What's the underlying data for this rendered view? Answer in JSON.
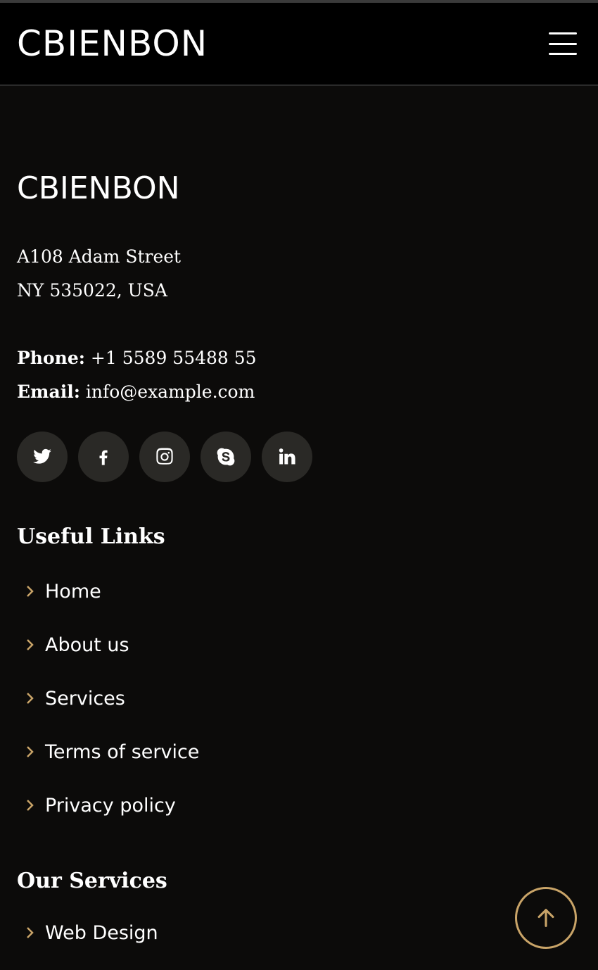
{
  "header": {
    "brand": "CBIENBON",
    "menu_icon": "hamburger-menu-icon"
  },
  "footer": {
    "brand": "CBIENBON",
    "address": {
      "line1": "A108 Adam Street",
      "line2": "NY 535022, USA"
    },
    "phone": {
      "label": "Phone:",
      "value": "+1 5589 55488 55"
    },
    "email": {
      "label": "Email:",
      "value": "info@example.com"
    },
    "social": [
      "twitter-icon",
      "facebook-icon",
      "instagram-icon",
      "skype-icon",
      "linkedin-icon"
    ],
    "useful_links": {
      "heading": "Useful Links",
      "items": [
        "Home",
        "About us",
        "Services",
        "Terms of service",
        "Privacy policy"
      ]
    },
    "our_services": {
      "heading": "Our Services",
      "items": [
        "Web Design"
      ]
    }
  },
  "colors": {
    "accent": "#c9a468",
    "background": "#0c0b0a",
    "header": "#000000",
    "social_bg": "#2a2926"
  }
}
